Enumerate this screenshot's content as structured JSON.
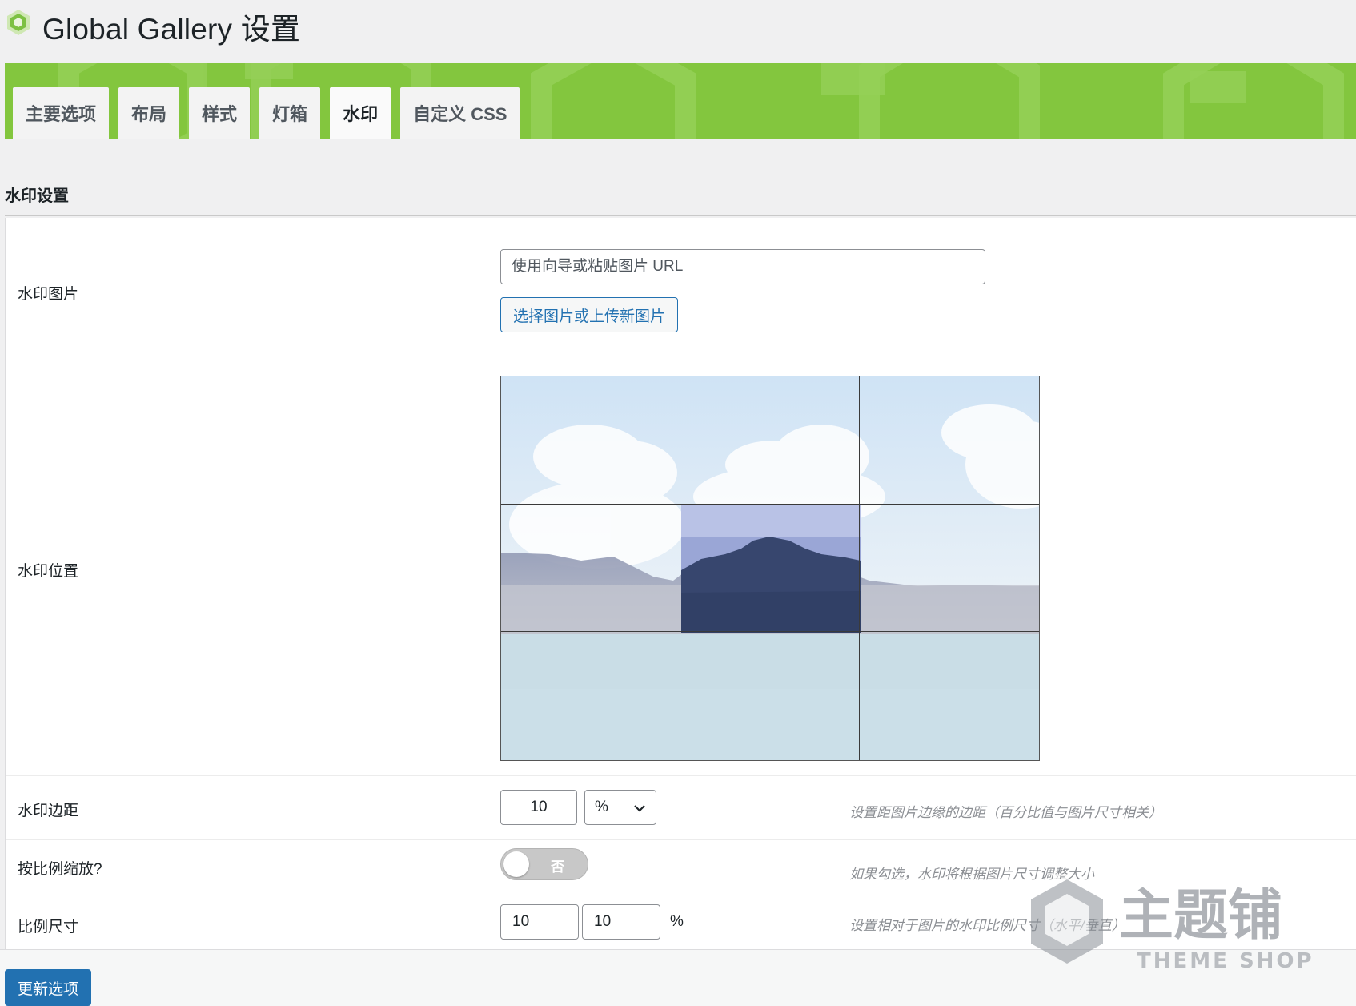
{
  "header": {
    "title": "Global Gallery 设置"
  },
  "tabs": [
    {
      "label": "主要选项",
      "active": false
    },
    {
      "label": "布局",
      "active": false
    },
    {
      "label": "样式",
      "active": false
    },
    {
      "label": "灯箱",
      "active": false
    },
    {
      "label": "水印",
      "active": true
    },
    {
      "label": "自定义 CSS",
      "active": false
    }
  ],
  "section": {
    "title": "水印设置"
  },
  "watermark_image": {
    "label": "水印图片",
    "input_placeholder": "使用向导或粘贴图片 URL",
    "button_label": "选择图片或上传新图片"
  },
  "watermark_position": {
    "label": "水印位置",
    "selected_cell": "middle-center"
  },
  "watermark_margin": {
    "label": "水印边距",
    "value": "10",
    "unit": "%",
    "hint": "设置距图片边缘的边距（百分比值与图片尺寸相关）"
  },
  "proportional_scale": {
    "label": "按比例缩放?",
    "toggle_label": "否",
    "enabled": false,
    "hint": "如果勾选，水印将根据图片尺寸调整大小"
  },
  "proportional_size": {
    "label": "比例尺寸",
    "value_h": "10",
    "value_v": "10",
    "unit": "%",
    "hint": "设置相对于图片的水印比例尺寸（水平/垂直）"
  },
  "footer": {
    "update_button": "更新选项"
  },
  "brand_watermark": {
    "text_cn": "主题铺",
    "text_en": "THEME SHOP"
  },
  "colors": {
    "banner": "#83c63e",
    "primary": "#2271b1",
    "toggle_off": "#c8c8c8"
  },
  "icons": {
    "logo": "hexagon-logo-icon",
    "select_arrow": "chevron-down-icon"
  }
}
